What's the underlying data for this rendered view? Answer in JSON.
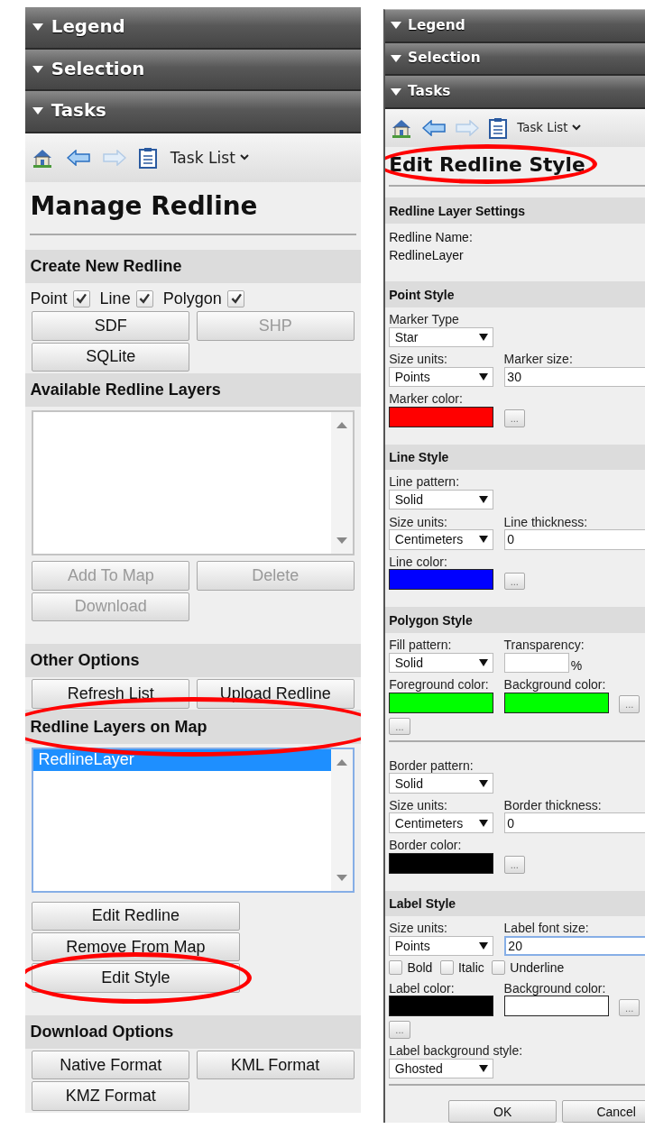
{
  "panels": [
    {
      "accordion": [
        {
          "label": "Legend",
          "expanded": true
        },
        {
          "label": "Selection",
          "expanded": true
        },
        {
          "label": "Tasks",
          "expanded": true
        }
      ],
      "toolbar": {
        "task_list": "Task List"
      },
      "title": "Manage Redline",
      "title_circled": false,
      "sections": [
        {
          "heading": "Create New Redline",
          "circled": false,
          "blocks": [
            {
              "kind": "label_checks",
              "items": [
                {
                  "label": "Point",
                  "checked": true
                },
                {
                  "label": "Line",
                  "checked": true
                },
                {
                  "label": "Polygon",
                  "checked": true
                }
              ]
            },
            {
              "kind": "buttons",
              "items": [
                {
                  "label": "SDF",
                  "disabled": false,
                  "circled": false
                },
                {
                  "label": "SHP",
                  "disabled": true,
                  "circled": false
                },
                {
                  "label": "SQLite",
                  "disabled": false,
                  "circled": false
                }
              ]
            }
          ]
        },
        {
          "heading": "Available Redline Layers",
          "circled": false,
          "blocks": [
            {
              "kind": "listbox",
              "focused": false
            },
            {
              "kind": "buttons",
              "items": [
                {
                  "label": "Add To Map",
                  "disabled": true,
                  "circled": false
                },
                {
                  "label": "Delete",
                  "disabled": true,
                  "circled": false
                },
                {
                  "label": "Download",
                  "disabled": true,
                  "circled": false
                }
              ]
            }
          ]
        },
        {
          "heading": "Other Options",
          "circled": false,
          "blocks": [
            {
              "kind": "buttons",
              "items": [
                {
                  "label": "Refresh List",
                  "disabled": false,
                  "circled": false
                },
                {
                  "label": "Upload Redline",
                  "disabled": false,
                  "circled": false
                }
              ]
            }
          ]
        },
        {
          "heading": "Redline Layers on Map",
          "circled": true,
          "blocks": [
            {
              "kind": "listbox",
              "focused": true,
              "items": [
                {
                  "label": "RedlineLayer",
                  "selected": true
                }
              ]
            },
            {
              "kind": "stack",
              "items": [
                {
                  "label": "Edit Redline",
                  "disabled": false,
                  "circled": false
                },
                {
                  "label": "Remove From Map",
                  "disabled": false,
                  "circled": false
                },
                {
                  "label": "Edit Style",
                  "disabled": false,
                  "circled": true
                }
              ]
            }
          ]
        },
        {
          "heading": "Download Options",
          "circled": false,
          "blocks": [
            {
              "kind": "buttons",
              "items": [
                {
                  "label": "Native Format",
                  "disabled": false,
                  "circled": false
                },
                {
                  "label": "KML Format",
                  "disabled": false,
                  "circled": false
                },
                {
                  "label": "KMZ Format",
                  "disabled": false,
                  "circled": false
                }
              ]
            }
          ]
        }
      ]
    },
    {
      "accordion": [
        {
          "label": "Legend",
          "expanded": true
        },
        {
          "label": "Selection",
          "expanded": true
        },
        {
          "label": "Tasks",
          "expanded": true
        }
      ],
      "toolbar": {
        "task_list": "Task List"
      },
      "title": "Edit Redline Style",
      "title_circled": true,
      "sections": [
        {
          "heading": "Redline Layer Settings",
          "circled": false,
          "blocks": [
            {
              "kind": "info",
              "label": "Redline Name:",
              "value": "RedlineLayer"
            }
          ]
        },
        {
          "heading": "Point Style",
          "circled": false,
          "blocks": [
            {
              "kind": "fields",
              "fields": [
                {
                  "kind": "select",
                  "label": "Marker Type",
                  "value": "Star"
                }
              ]
            },
            {
              "kind": "fields",
              "fields": [
                {
                  "kind": "select",
                  "label": "Size units:",
                  "value": "Points"
                },
                {
                  "kind": "input",
                  "label": "Marker size:",
                  "value": "30",
                  "focused": false
                }
              ]
            },
            {
              "kind": "fields",
              "fields": [
                {
                  "kind": "color",
                  "label": "Marker color:",
                  "color": "#ff0000"
                },
                {
                  "kind": "more",
                  "label": "..."
                }
              ]
            }
          ]
        },
        {
          "heading": "Line Style",
          "circled": false,
          "blocks": [
            {
              "kind": "fields",
              "fields": [
                {
                  "kind": "select",
                  "label": "Line pattern:",
                  "value": "Solid"
                }
              ]
            },
            {
              "kind": "fields",
              "fields": [
                {
                  "kind": "select",
                  "label": "Size units:",
                  "value": "Centimeters"
                },
                {
                  "kind": "input",
                  "label": "Line thickness:",
                  "value": "0",
                  "focused": false
                }
              ]
            },
            {
              "kind": "fields",
              "fields": [
                {
                  "kind": "color",
                  "label": "Line color:",
                  "color": "#0000ff"
                },
                {
                  "kind": "more",
                  "label": "..."
                }
              ]
            }
          ]
        },
        {
          "heading": "Polygon Style",
          "circled": false,
          "blocks": [
            {
              "kind": "fields",
              "fields": [
                {
                  "kind": "select",
                  "label": "Fill pattern:",
                  "value": "Solid"
                },
                {
                  "kind": "input",
                  "label": "Transparency:",
                  "suffix": "%",
                  "focused": false
                }
              ]
            },
            {
              "kind": "fields",
              "fields": [
                {
                  "kind": "color",
                  "label": "Foreground color:",
                  "color": "#00ff00"
                },
                {
                  "kind": "color",
                  "label": "Background color:",
                  "color": "#00ff00"
                },
                {
                  "kind": "more",
                  "label": "..."
                }
              ]
            },
            {
              "kind": "fields",
              "fields": [
                {
                  "kind": "more",
                  "label": "..."
                }
              ]
            },
            {
              "kind": "rule"
            },
            {
              "kind": "fields",
              "fields": [
                {
                  "kind": "select",
                  "label": "Border pattern:",
                  "value": "Solid"
                }
              ]
            },
            {
              "kind": "fields",
              "fields": [
                {
                  "kind": "select",
                  "label": "Size units:",
                  "value": "Centimeters"
                },
                {
                  "kind": "input",
                  "label": "Border thickness:",
                  "value": "0",
                  "focused": false
                }
              ]
            },
            {
              "kind": "fields",
              "fields": [
                {
                  "kind": "color",
                  "label": "Border color:",
                  "color": "#000000"
                },
                {
                  "kind": "more",
                  "label": "..."
                }
              ]
            }
          ]
        },
        {
          "heading": "Label Style",
          "circled": false,
          "blocks": [
            {
              "kind": "fields",
              "fields": [
                {
                  "kind": "select",
                  "label": "Size units:",
                  "value": "Points"
                },
                {
                  "kind": "input",
                  "label": "Label font size:",
                  "value": "20",
                  "focused": true
                }
              ]
            },
            {
              "kind": "checks",
              "items": [
                {
                  "label": "Bold",
                  "checked": false
                },
                {
                  "label": "Italic",
                  "checked": false
                },
                {
                  "label": "Underline",
                  "checked": false
                }
              ]
            },
            {
              "kind": "fields",
              "fields": [
                {
                  "kind": "color",
                  "label": "Label color:",
                  "color": "#000000"
                },
                {
                  "kind": "color",
                  "label": "Background color:",
                  "color": "#ffffff"
                },
                {
                  "kind": "more",
                  "label": "..."
                }
              ]
            },
            {
              "kind": "fields",
              "fields": [
                {
                  "kind": "more",
                  "label": "..."
                }
              ]
            },
            {
              "kind": "fields",
              "fields": [
                {
                  "kind": "select",
                  "label": "Label background style:",
                  "value": "Ghosted"
                }
              ]
            }
          ]
        }
      ],
      "actions": [
        {
          "label": "OK"
        },
        {
          "label": "Cancel"
        }
      ]
    }
  ]
}
